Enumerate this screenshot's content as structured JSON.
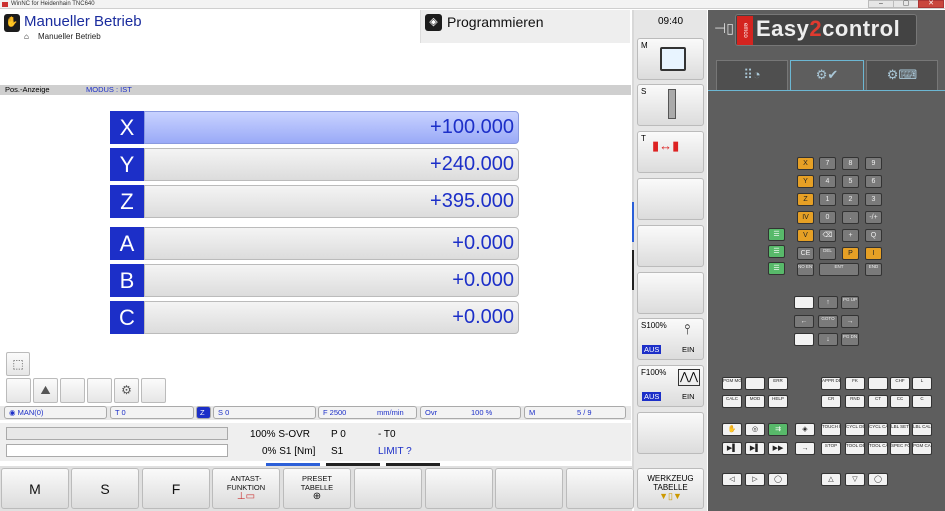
{
  "window": {
    "title": "WinNC for Heidenhain TNC640",
    "buttons": [
      "–",
      "▢",
      "✕"
    ]
  },
  "mode": {
    "title": "Manueller Betrieb",
    "subtitle": "Manueller Betrieb"
  },
  "program_mode": {
    "title": "Programmieren"
  },
  "posbar": {
    "label": "Pos.-Anzeige",
    "modus": "MODUS : IST"
  },
  "axes": [
    {
      "letter": "X",
      "value": "+100.000"
    },
    {
      "letter": "Y",
      "value": "+240.000"
    },
    {
      "letter": "Z",
      "value": "+395.000"
    },
    {
      "letter": "A",
      "value": "+0.000"
    },
    {
      "letter": "B",
      "value": "+0.000"
    },
    {
      "letter": "C",
      "value": "+0.000"
    }
  ],
  "status": {
    "man": "MAN(0)",
    "t": "T  0",
    "z": "Z",
    "s": "S    0",
    "f": "F  2500",
    "unit": "mm/min",
    "ovr": "Ovr",
    "ovr_val": "100 %",
    "m": "M",
    "m_val": "5 / 9"
  },
  "overrides": {
    "s_ovr": "100% S-OVR",
    "p0": "P 0",
    "t0": "- T0",
    "s1": "0% S1 [Nm]",
    "s1b": "S1",
    "limit": "LIMIT  ?",
    "s_fill_pct": 100,
    "f_fill_pct": 0
  },
  "softkeys": [
    {
      "label": "M"
    },
    {
      "label": "S"
    },
    {
      "label": "F"
    },
    {
      "label": "ANTAST-\nFUNKTION"
    },
    {
      "label": "PRESET\nTABELLE"
    },
    {
      "label": ""
    },
    {
      "label": ""
    },
    {
      "label": ""
    },
    {
      "label": ""
    }
  ],
  "right_column": {
    "time": "09:40",
    "m_label": "M",
    "s_label": "S",
    "t_label": "T",
    "s100": "S100%",
    "aus1": "AUS",
    "ein1": "EIN",
    "f100": "F100%",
    "aus2": "AUS",
    "ein2": "EIN",
    "werkzeug": "WERKZEUG\nTABELLE"
  },
  "panel": {
    "brand_emco": "emco",
    "brand_text1": "Easy",
    "brand_two": "2",
    "brand_text2": "control",
    "axis_keys": [
      "X",
      "Y",
      "Z",
      "IV",
      "V",
      "CE",
      "P",
      "I"
    ],
    "num_keys": [
      "7",
      "8",
      "9",
      "4",
      "5",
      "6",
      "1",
      "2",
      "3",
      "0",
      ".",
      "-/+",
      "⌫",
      "+",
      "Q",
      "NO ENT",
      "ENT",
      "END"
    ],
    "nav_keys": [
      "PG UP",
      "PG DN",
      "GOTO"
    ],
    "fn_keys_row1": [
      "PGM MGT",
      "ERR",
      "APPR DEP",
      "FK",
      "CHF",
      "L"
    ],
    "fn_keys_row2": [
      "CALC",
      "MOD",
      "HELP",
      "CR",
      "RND",
      "CT",
      "CC",
      "C"
    ],
    "fn_keys_row3": [
      "TOUCH PROBE",
      "CYCL DEF",
      "CYCL CALL",
      "LBL SET",
      "LBL CALL"
    ],
    "fn_keys_row4": [
      "STOP",
      "TOOL DEF",
      "TOOL CALL",
      "SPEC FCT",
      "PGM CALL"
    ]
  },
  "colors": {
    "axis_blue": "#1c2fc8",
    "panel_bg": "#5e5e5e",
    "accent_orange": "#e6a025",
    "accent_green": "#58b96a",
    "brand_red": "#d4241f"
  }
}
